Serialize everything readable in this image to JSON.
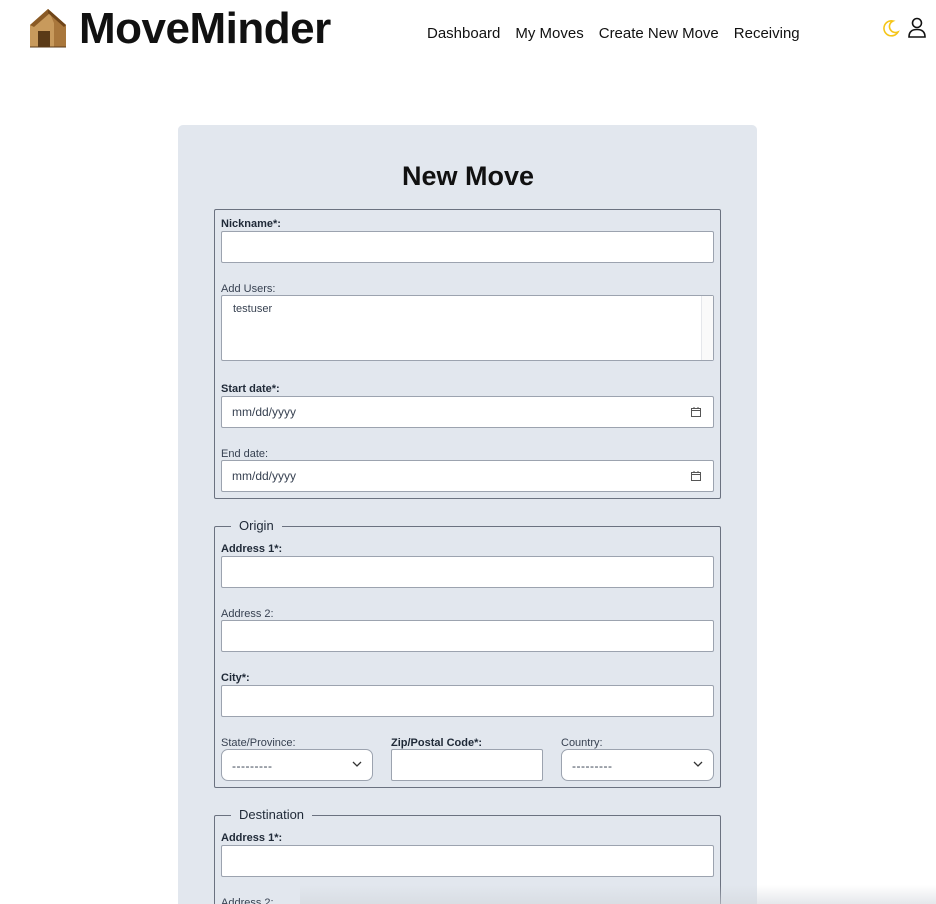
{
  "app": {
    "name": "MoveMinder"
  },
  "nav": {
    "dashboard": "Dashboard",
    "my_moves": "My Moves",
    "create_new_move": "Create New Move",
    "receiving": "Receiving"
  },
  "colors": {
    "moon": "#f5c518",
    "card_bg": "#e2e7ee"
  },
  "icons": {
    "logo": "box-house-icon",
    "theme": "moon-icon",
    "account": "user-icon"
  },
  "form": {
    "title": "New Move",
    "general": {
      "nickname_label": "Nickname*:",
      "nickname_value": "",
      "add_users_label": "Add Users:",
      "users": [
        "testuser"
      ],
      "start_date_label": "Start date*:",
      "start_date_placeholder": "mm/dd/yyyy",
      "end_date_label": "End date:",
      "end_date_placeholder": "mm/dd/yyyy"
    },
    "origin": {
      "legend": "Origin",
      "address1_label": "Address 1*:",
      "address2_label": "Address 2:",
      "city_label": "City*:",
      "state_label": "State/Province:",
      "state_value": "---------",
      "zip_label": "Zip/Postal Code*:",
      "country_label": "Country:",
      "country_value": "---------"
    },
    "destination": {
      "legend": "Destination",
      "address1_label": "Address 1*:",
      "address2_label": "Address 2:"
    }
  }
}
